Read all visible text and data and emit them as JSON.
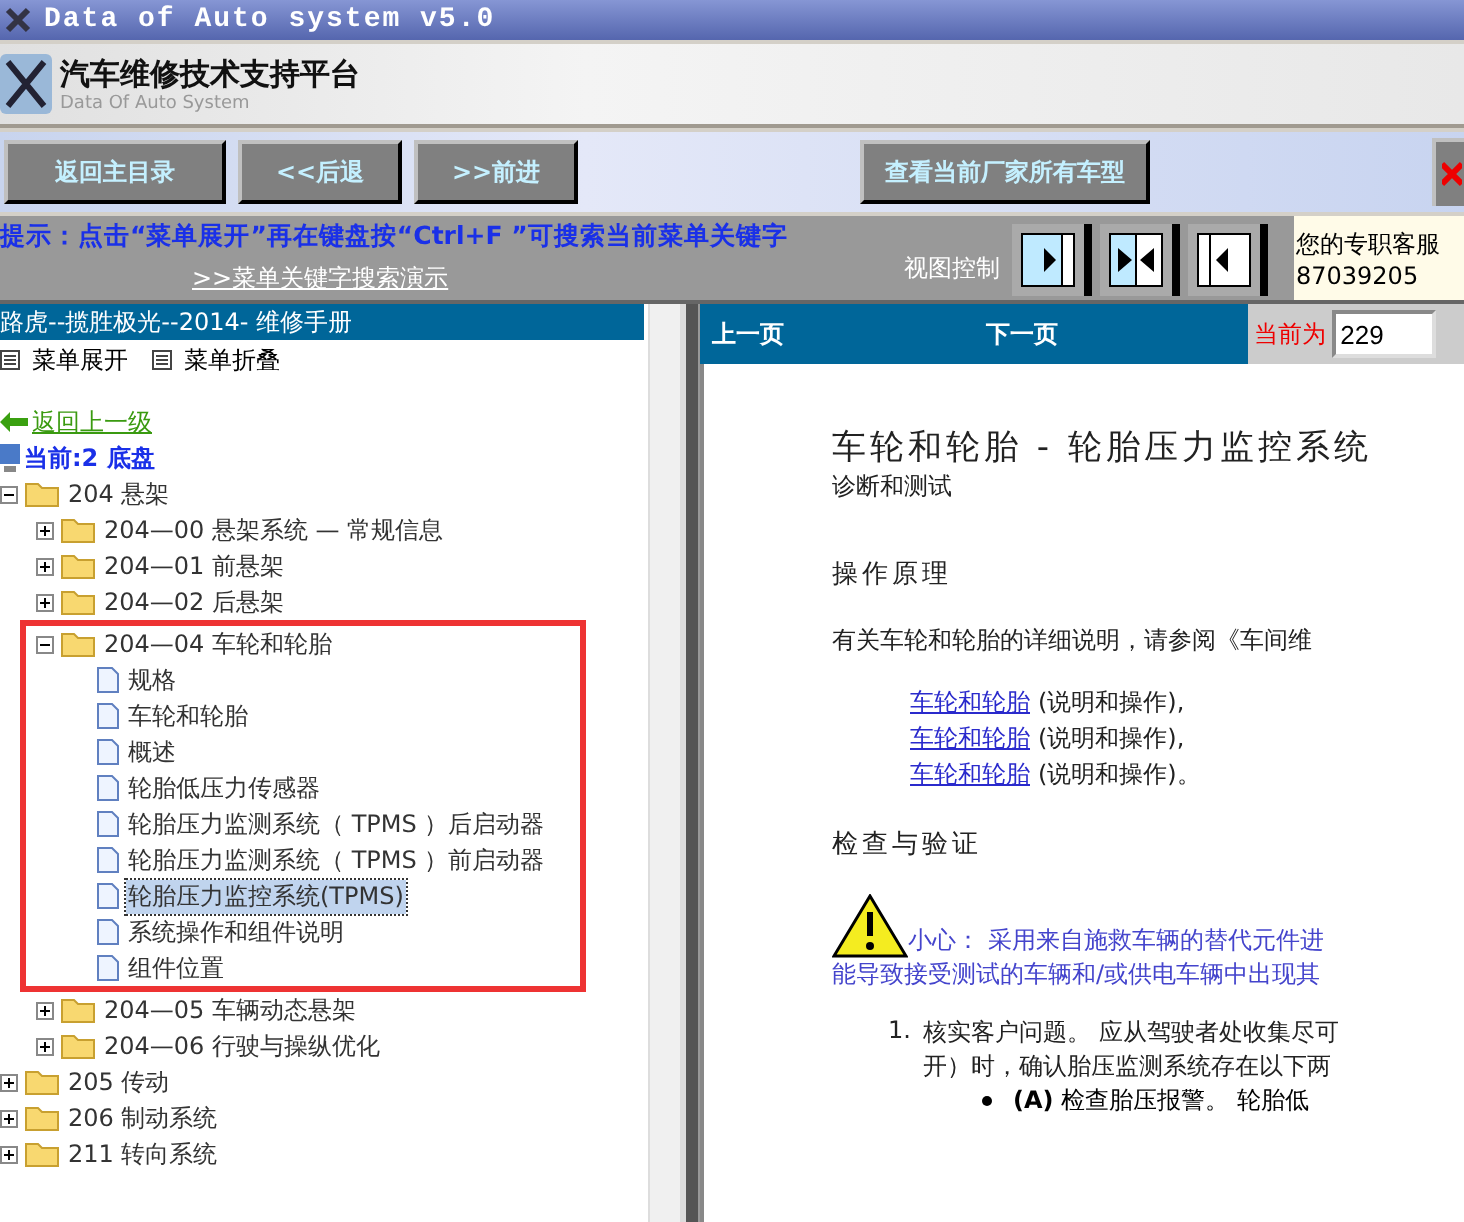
{
  "window": {
    "title": "Data of Auto system v5.0"
  },
  "header": {
    "title": "汽车维修技术支持平台",
    "subtitle": "Data Of Auto System"
  },
  "toolbar": {
    "buttons": [
      "返回主目录",
      "<<后退",
      ">>前进"
    ],
    "right_button": "查看当前厂家所有车型"
  },
  "hint": {
    "text": "提示：点击“菜单展开”再在键盘按“Ctrl+F ”可搜索当前菜单关键字",
    "link": ">>菜单关键字搜索演示"
  },
  "view_control": {
    "label": "视图控制",
    "buttons": [
      {
        "kind": "left"
      },
      {
        "kind": "split"
      },
      {
        "kind": "right"
      }
    ]
  },
  "support": {
    "label": "您的专职客服",
    "phone": "87039205"
  },
  "sidebar": {
    "title": "路虎--揽胜极光--2014- 维修手册",
    "actions": [
      "菜单展开",
      "菜单折叠"
    ],
    "back_link": "返回上一级",
    "current": "当前:2 底盘",
    "tree": [
      {
        "kind": "folder",
        "label": "204 悬架",
        "expanded": true,
        "selected": false,
        "children": [
          {
            "kind": "folder",
            "label": "204—00 悬架系统 — 常规信息",
            "expanded": false,
            "selected": false
          },
          {
            "kind": "folder",
            "label": "204—01 前悬架",
            "expanded": false,
            "selected": false
          },
          {
            "kind": "folder",
            "label": "204—02 后悬架",
            "expanded": false,
            "selected": false
          },
          {
            "kind": "folder",
            "label": "204—04 车轮和轮胎",
            "expanded": true,
            "selected": false,
            "highlighted": true,
            "children": [
              {
                "kind": "page",
                "label": "规格",
                "selected": false
              },
              {
                "kind": "page",
                "label": "车轮和轮胎",
                "selected": false
              },
              {
                "kind": "page",
                "label": "概述",
                "selected": false
              },
              {
                "kind": "page",
                "label": "轮胎低压力传感器",
                "selected": false
              },
              {
                "kind": "page",
                "label": "轮胎压力监测系统（ TPMS ）后启动器",
                "selected": false
              },
              {
                "kind": "page",
                "label": "轮胎压力监测系统（ TPMS ）前启动器",
                "selected": false
              },
              {
                "kind": "page",
                "label": "轮胎压力监控系统(TPMS)",
                "selected": true
              },
              {
                "kind": "page",
                "label": "系统操作和组件说明",
                "selected": false
              },
              {
                "kind": "page",
                "label": "组件位置",
                "selected": false
              }
            ]
          },
          {
            "kind": "folder",
            "label": "204—05 车辆动态悬架",
            "expanded": false,
            "selected": false
          },
          {
            "kind": "folder",
            "label": "204—06 行驶与操纵优化",
            "expanded": false,
            "selected": false
          }
        ]
      },
      {
        "kind": "folder",
        "label": "205 传动",
        "expanded": false,
        "selected": false
      },
      {
        "kind": "folder",
        "label": "206 制动系统",
        "expanded": false,
        "selected": false
      },
      {
        "kind": "folder",
        "label": "211 转向系统",
        "expanded": false,
        "selected": false
      }
    ]
  },
  "pager": {
    "prev": "上一页",
    "next": "下一页",
    "current_label": "当前为",
    "page": "229"
  },
  "document": {
    "title": "车轮和轮胎 - 轮胎压力监控系统",
    "subtitle": "诊断和测试",
    "heading1": "操作原理",
    "intro": "有关车轮和轮胎的详细说明，请参阅《车间维",
    "references": [
      {
        "link": "车轮和轮胎",
        "text": "(说明和操作),"
      },
      {
        "link": "车轮和轮胎",
        "text": "(说明和操作),"
      },
      {
        "link": "车轮和轮胎",
        "text": "(说明和操作)。"
      }
    ],
    "heading2": "检查与验证",
    "caution": [
      "小心： 采用来自施救车辆的替代元件进",
      "能导致接受测试的车辆和/或供电车辆中出现其"
    ],
    "steps": [
      {
        "number": "1.",
        "lines": [
          "核实客户问题。 应从驾驶者处收集尽可",
          "开）时，确认胎压监测系统存在以下两"
        ],
        "bullets": [
          "**(A)** 检查胎压报警。 轮胎低"
        ]
      }
    ]
  }
}
